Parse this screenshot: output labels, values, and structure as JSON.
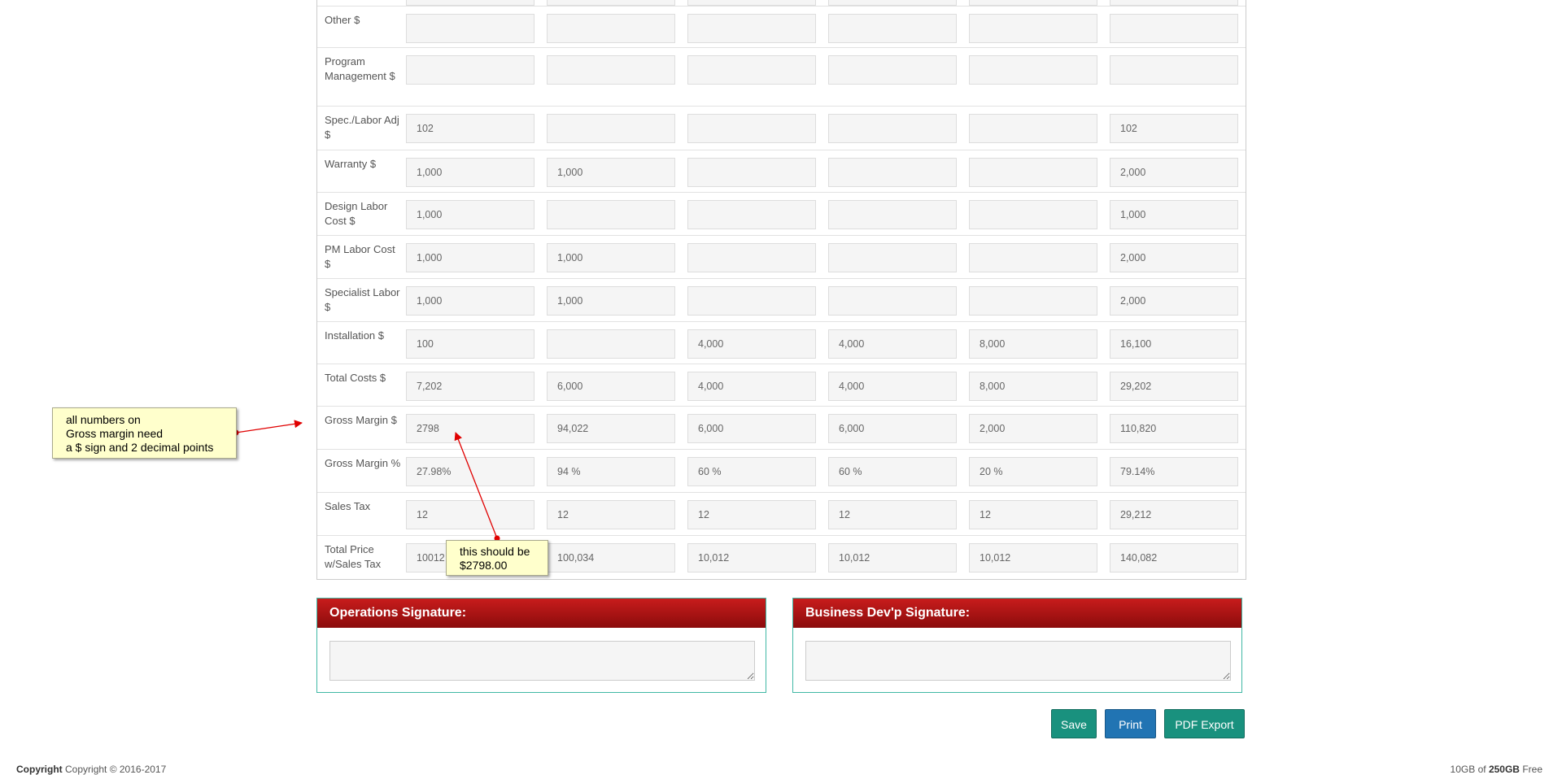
{
  "table": {
    "rows": [
      {
        "label": "",
        "values": [
          "",
          "",
          "",
          "",
          "",
          ""
        ]
      },
      {
        "label": "Other $",
        "values": [
          "",
          "",
          "",
          "",
          "",
          ""
        ]
      },
      {
        "label": "Program Management $",
        "values": [
          "",
          "",
          "",
          "",
          "",
          ""
        ]
      },
      {
        "label": "Spec./Labor Adj $",
        "values": [
          "102",
          "",
          "",
          "",
          "",
          "102"
        ]
      },
      {
        "label": "Warranty $",
        "values": [
          "1,000",
          "1,000",
          "",
          "",
          "",
          "2,000"
        ]
      },
      {
        "label": "Design Labor Cost $",
        "values": [
          "1,000",
          "",
          "",
          "",
          "",
          "1,000"
        ]
      },
      {
        "label": "PM Labor Cost $",
        "values": [
          "1,000",
          "1,000",
          "",
          "",
          "",
          "2,000"
        ]
      },
      {
        "label": "Specialist Labor $",
        "values": [
          "1,000",
          "1,000",
          "",
          "",
          "",
          "2,000"
        ]
      },
      {
        "label": "Installation $",
        "values": [
          "100",
          "",
          "4,000",
          "4,000",
          "8,000",
          "16,100"
        ]
      },
      {
        "label": "Total Costs $",
        "values": [
          "7,202",
          "6,000",
          "4,000",
          "4,000",
          "8,000",
          "29,202"
        ]
      },
      {
        "label": "Gross Margin $",
        "values": [
          "2798",
          "94,022",
          "6,000",
          "6,000",
          "2,000",
          "110,820"
        ]
      },
      {
        "label": "Gross Margin %",
        "values": [
          "27.98%",
          "94 %",
          "60 %",
          "60 %",
          "20 %",
          "79.14%"
        ]
      },
      {
        "label": "Sales Tax",
        "values": [
          "12",
          "12",
          "12",
          "12",
          "12",
          "29,212"
        ]
      },
      {
        "label": "Total Price w/Sales Tax",
        "values": [
          "10012",
          "100,034",
          "10,012",
          "10,012",
          "10,012",
          "140,082"
        ]
      }
    ]
  },
  "annotations": {
    "note1": [
      "all numbers on",
      "Gross margin need",
      "a $ sign and 2 decimal points"
    ],
    "note2": [
      "this should be",
      "$2798.00"
    ]
  },
  "signatures": {
    "operations_title": "Operations Signature:",
    "business_title": "Business Dev'p Signature:"
  },
  "actions": {
    "save": "Save",
    "print": "Print",
    "pdf_export": "PDF Export"
  },
  "footer": {
    "copyright_label": "Copyright",
    "copyright_text": "Copyright © 2016-2017",
    "storage_used": "10GB",
    "storage_of": "of",
    "storage_total": "250GB",
    "storage_suffix": "Free"
  },
  "colors": {
    "signature_header": "#a81414",
    "panel_border": "#40b8a5",
    "save_button": "#19917e",
    "print_button": "#2174b3",
    "note_background": "#ffffcc",
    "arrow": "#e00000"
  }
}
